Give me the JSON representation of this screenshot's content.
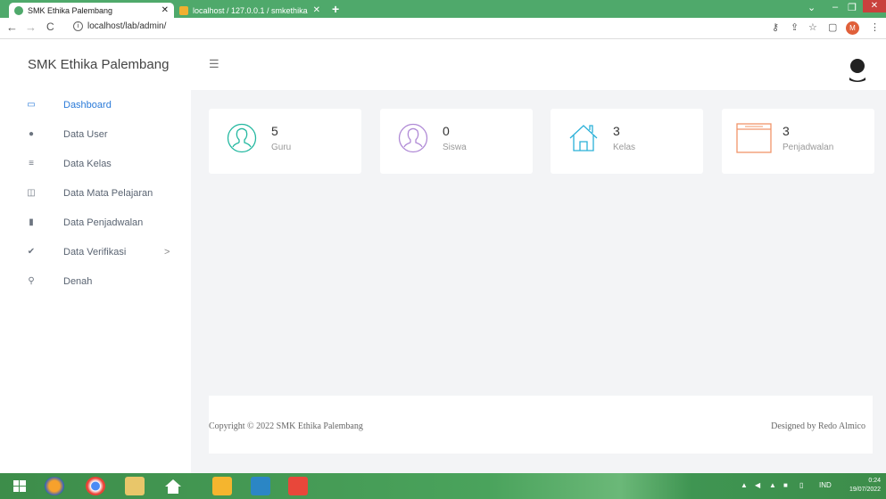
{
  "browser": {
    "tabs": [
      {
        "title": "SMK Ethika Palembang",
        "active": true
      },
      {
        "title": "localhost / 127.0.0.1 / smkethika",
        "active": false
      }
    ],
    "url": "localhost/lab/admin/",
    "profile_initial": "M"
  },
  "app": {
    "brand": "SMK Ethika Palembang",
    "sidebar": [
      {
        "label": "Dashboard",
        "icon": "laptop-icon",
        "active": true
      },
      {
        "label": "Data User",
        "icon": "user-icon"
      },
      {
        "label": "Data Kelas",
        "icon": "list-icon"
      },
      {
        "label": "Data Mata Pelajaran",
        "icon": "book-icon"
      },
      {
        "label": "Data Penjadwalan",
        "icon": "file-icon"
      },
      {
        "label": "Data Verifikasi",
        "icon": "check-icon",
        "chevron": ">"
      },
      {
        "label": "Denah",
        "icon": "map-pin-icon"
      }
    ],
    "stats": [
      {
        "value": "5",
        "label": "Guru",
        "icon": "user-circle-icon",
        "color": "#24b8a0"
      },
      {
        "value": "0",
        "label": "Siswa",
        "icon": "user-circle-icon",
        "color": "#b08ad6"
      },
      {
        "value": "3",
        "label": "Kelas",
        "icon": "home-icon",
        "color": "#2ab0d8"
      },
      {
        "value": "3",
        "label": "Penjadwalan",
        "icon": "browser-window-icon",
        "color": "#f0956a"
      }
    ],
    "footer": {
      "copyright": "Copyright © 2022 SMK Ethika Palembang",
      "designed_by": "Designed by Redo Almico"
    }
  },
  "taskbar": {
    "language": "IND",
    "time": "0:24",
    "date": "19/07/2022"
  }
}
